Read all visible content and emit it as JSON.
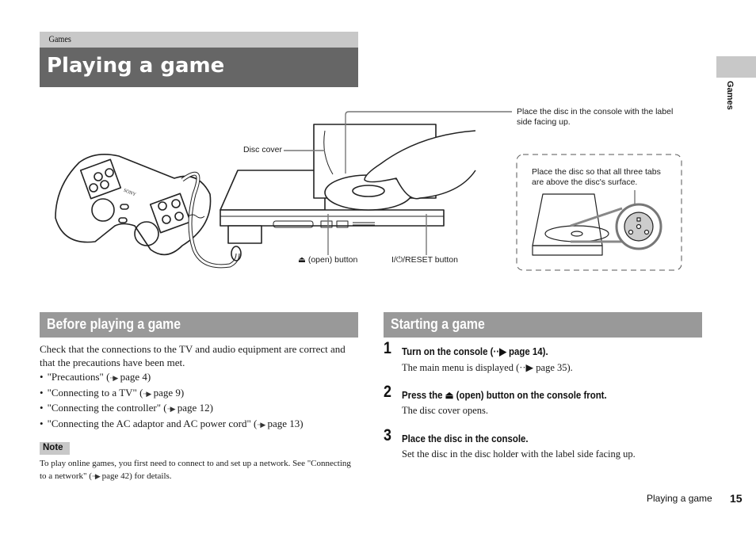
{
  "header": {
    "section": "Games",
    "title": "Playing a game"
  },
  "side_tab": {
    "label": "Games"
  },
  "illustration": {
    "callouts": {
      "disc_placement": "Place the disc in the console with the label side facing up.",
      "disc_cover": "Disc cover",
      "tabs": "Place the disc so that all three tabs are above the disc's surface.",
      "open_button": "⏏ (open) button",
      "reset_button": "I/⏻/RESET button"
    },
    "controller_brand": "SONY"
  },
  "before": {
    "heading": "Before playing a game",
    "intro": "Check that the connections to the TV and audio equipment are correct and that the precautions have been met.",
    "items": [
      {
        "text": "\"Precautions\" (",
        "arrow": "··▶",
        "ref": " page 4)"
      },
      {
        "text": "\"Connecting to a TV\" (",
        "arrow": "··▶",
        "ref": " page 9)"
      },
      {
        "text": "\"Connecting the controller\" (",
        "arrow": "··▶",
        "ref": " page 12)"
      },
      {
        "text": "\"Connecting the AC adaptor and AC power cord\" (",
        "arrow": "··▶",
        "ref": " page 13)"
      }
    ],
    "note": {
      "label": "Note",
      "text_a": "To play online games, you first need to connect to and set up a network. See \"Connecting to a network\" (",
      "arrow": "··▶",
      "text_b": " page 42) for details."
    }
  },
  "starting": {
    "heading": "Starting a game",
    "steps": [
      {
        "num": "1",
        "title": "Turn on the console (··▶ page 14).",
        "desc": "The main menu is displayed (··▶ page 35)."
      },
      {
        "num": "2",
        "title": "Press the ⏏ (open) button on the console front.",
        "desc": "The disc cover opens."
      },
      {
        "num": "3",
        "title": "Place the disc in the console.",
        "desc": "Set the disc in the disc holder with the label side facing up."
      }
    ]
  },
  "footer": {
    "label": "Playing a game",
    "page": "15"
  }
}
